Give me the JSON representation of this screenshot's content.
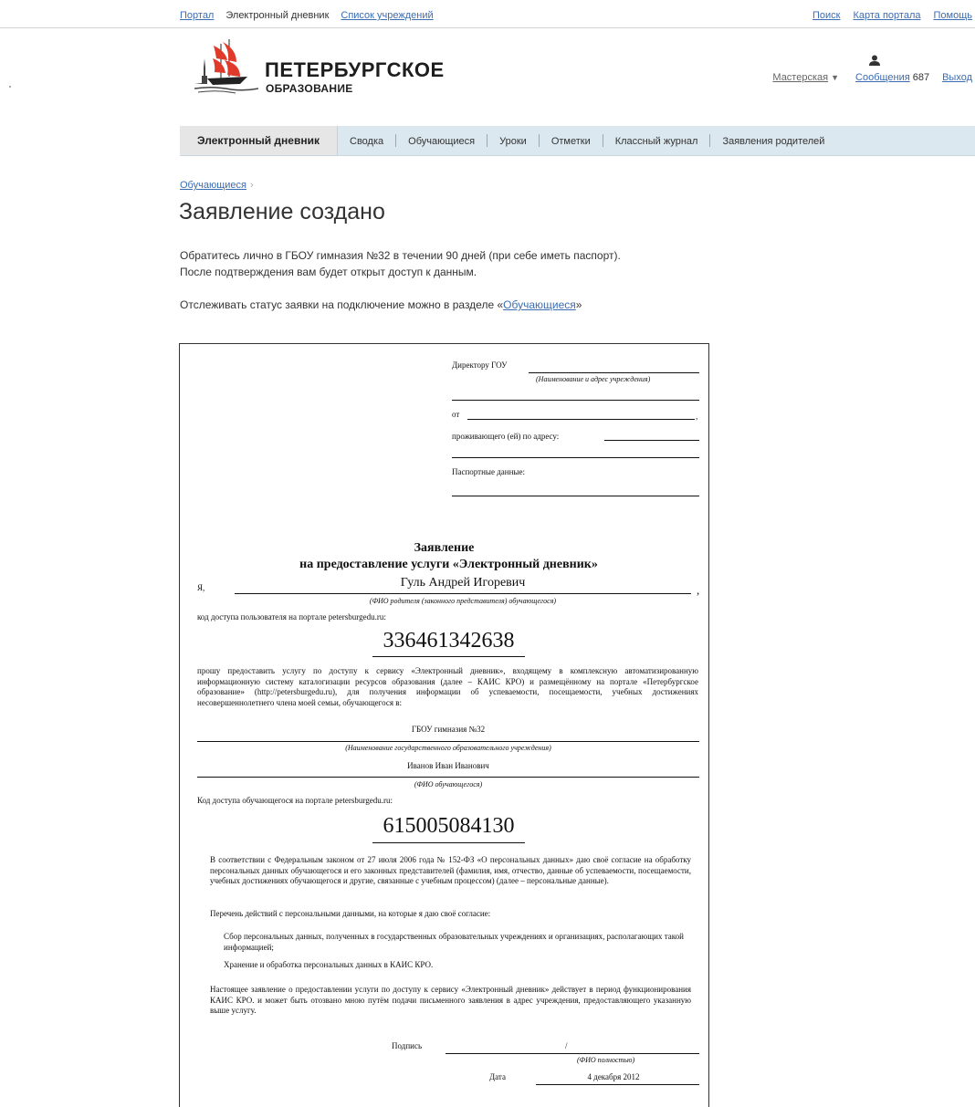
{
  "topnav": {
    "portal": "Портал",
    "diary": "Электронный дневник",
    "institutions": "Список учреждений",
    "search": "Поиск",
    "sitemap": "Карта портала",
    "help": "Помощь"
  },
  "header": {
    "logo_line1": "ПЕТЕРБУРГСКОЕ",
    "logo_line2": "ОБРАЗОВАНИЕ",
    "workshop": "Мастерская",
    "workshop_arrow": "▼",
    "messages": "Сообщения",
    "messages_count": "687",
    "logout": "Выход"
  },
  "menu": {
    "active": "Электронный дневник",
    "items": [
      "Сводка",
      "Обучающиеся",
      "Уроки",
      "Отметки",
      "Классный журнал",
      "Заявления родителей"
    ]
  },
  "breadcrumb": {
    "link": "Обучающиеся",
    "chevron": "›"
  },
  "page": {
    "title": "Заявление создано",
    "info_line1": "Обратитесь лично в ГБОУ гимназия №32 в течении 90 дней (при себе иметь паспорт).",
    "info_line2": "После подтверждения вам будет открыт доступ к данным.",
    "track_prefix": "Отслеживать статус заявки на подключение можно в разделе «",
    "track_link": "Обучающиеся",
    "track_suffix": "»"
  },
  "document": {
    "director": "Директору ГОУ",
    "director_hint": "(Наименование и адрес учреждения)",
    "from": "от",
    "comma": ",",
    "residing": "проживающего (ей) по адресу:",
    "passport": "Паспортные данные:",
    "title1": "Заявление",
    "title2": "на предоставление услуги «Электронный дневник»",
    "i_prefix": "Я,",
    "parent_name": "Гуль Андрей Игоревич",
    "parent_hint": "(ФИО родителя (законного представителя) обучающегося)",
    "user_code_label": "код доступа пользователя на портале petersburgedu.ru:",
    "user_code": "336461342638",
    "request_text": "прошу предоставить услугу по доступу к сервису «Электронный дневник», входящему в комплексную автоматизированную информационную систему каталогизации ресурсов образования (далее – КАИС КРО) и размещённому на портале «Петербургское образование» (http://petersburgedu.ru), для получения информации об успеваемости, посещаемости, учебных достижениях несовершеннолетнего члена моей семьи, обучающегося в:",
    "school": "ГБОУ гимназия №32",
    "school_hint": "(Наименование государственного образовательного учреждения)",
    "student_name": "Иванов Иван Иванович",
    "student_hint": "(ФИО обучающегося)",
    "student_code_label": "Код доступа обучающегося на портале petersburgedu.ru:",
    "student_code": "615005084130",
    "consent_text": "В соответствии с Федеральным законом от 27 июля 2006 года № 152-ФЗ «О персональных данных» даю своё согласие на обработку персональных данных обучающегося и его законных представителей (фамилия, имя, отчество, данные об успеваемости, посещаемости, учебных достижениях обучающегося и другие, связанные с учебным процессом) (далее – персональные данные).",
    "actions_label": "Перечень действий с персональными данными, на которые я даю своё согласие:",
    "action1": "Сбор персональных данных, полученных в государственных образовательных учреждениях и организациях, располагающих такой информацией;",
    "action2": "Хранение и обработка персональных данных в КАИС КРО.",
    "validity_text": "Настоящее заявление о предоставлении услуги по доступу к сервису «Электронный дневник» действует в период функционирования КАИС КРО. и может быть отозвано мною путём подачи письменного заявления в адрес учреждения, предоставляющего указанную выше услугу.",
    "signature_label": "Подпись",
    "slash": "/",
    "fullname_hint": "(ФИО полностью)",
    "date_label": "Дата",
    "date_value": "4 декабря 2012"
  },
  "colors": {
    "link": "#3b6db3",
    "menubar": "#dce8ef",
    "logo_red": "#e03a2a"
  }
}
